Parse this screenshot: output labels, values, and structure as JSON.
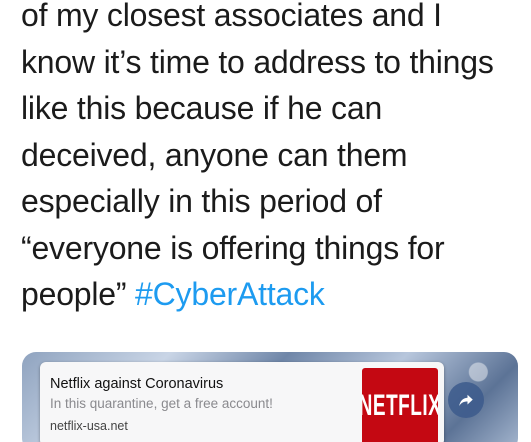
{
  "tweet": {
    "lines": [
      "of my closest associates and I",
      "know it’s time to address to things",
      "like this because if he can",
      "deceived, anyone can them",
      "especially in this period of",
      "“everyone is offering things for"
    ],
    "last_line_prefix": "people” ",
    "hashtag": "#CyberAttack"
  },
  "link_card": {
    "title": "Netflix against Coronavirus",
    "description": "In this quarantine, get a free account!",
    "domain": "netflix-usa.net",
    "logo_text": "NETFLIX",
    "logo_color": "#c40812"
  },
  "share_button": {
    "icon": "share-arrow-icon"
  },
  "colors": {
    "text": "#1b1b1b",
    "hashtag": "#1d9bf0"
  }
}
